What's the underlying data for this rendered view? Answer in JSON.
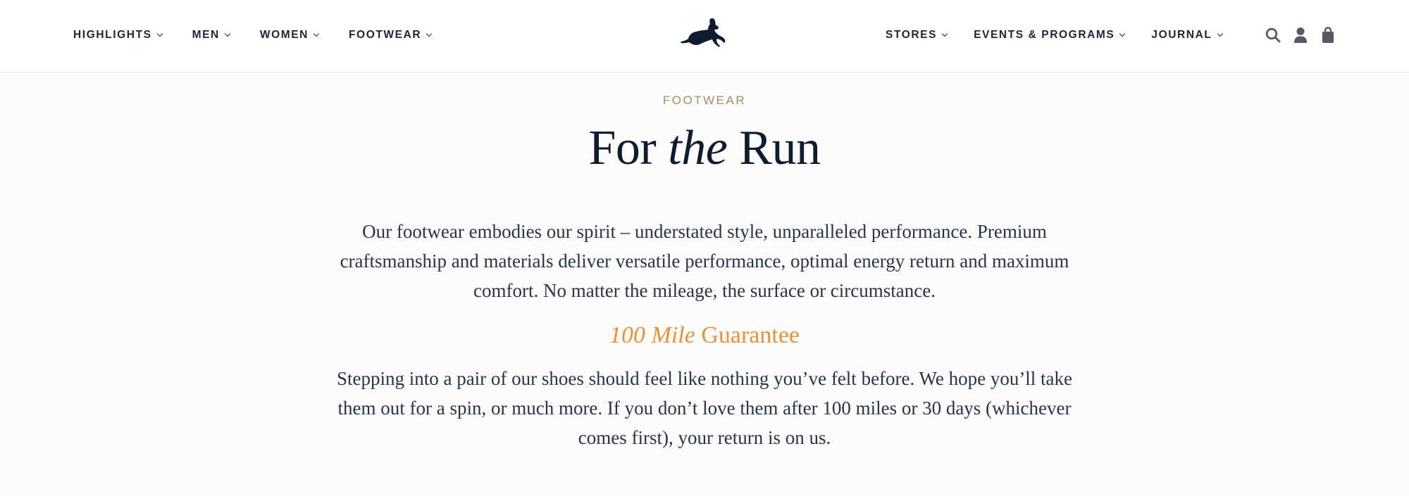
{
  "nav": {
    "left": [
      {
        "label": "HIGHLIGHTS"
      },
      {
        "label": "MEN"
      },
      {
        "label": "WOMEN"
      },
      {
        "label": "FOOTWEAR"
      }
    ],
    "right": [
      {
        "label": "STORES"
      },
      {
        "label": "EVENTS & PROGRAMS"
      },
      {
        "label": "JOURNAL"
      }
    ],
    "icons": [
      "search-icon",
      "account-icon",
      "bag-icon"
    ]
  },
  "logo": {
    "icon": "leaping-hare-logo"
  },
  "hero": {
    "eyebrow": "FOOTWEAR",
    "title_prefix": "For ",
    "title_em": "the",
    "title_suffix": " Run",
    "intro": "Our footwear embodies our spirit – understated style, unparalleled performance. Premium craftsmanship and materials deliver versatile performance, optimal energy return and maximum comfort. No matter the mileage, the surface or circumstance."
  },
  "guarantee": {
    "heading_em": "100 Mile",
    "heading_rest": " Guarantee",
    "body": "Stepping into a pair of our shoes should feel like nothing you’ve felt before. We hope you’ll take them out for a spin, or much more. If you don’t love them after 100 miles or 30 days (whichever comes first), your return is on us."
  },
  "colors": {
    "navy": "#0f1c30",
    "text": "#28344a",
    "eyebrow_gold": "#a98a64",
    "accent_orange": "#ec9134",
    "icon_gray": "#545b66"
  }
}
